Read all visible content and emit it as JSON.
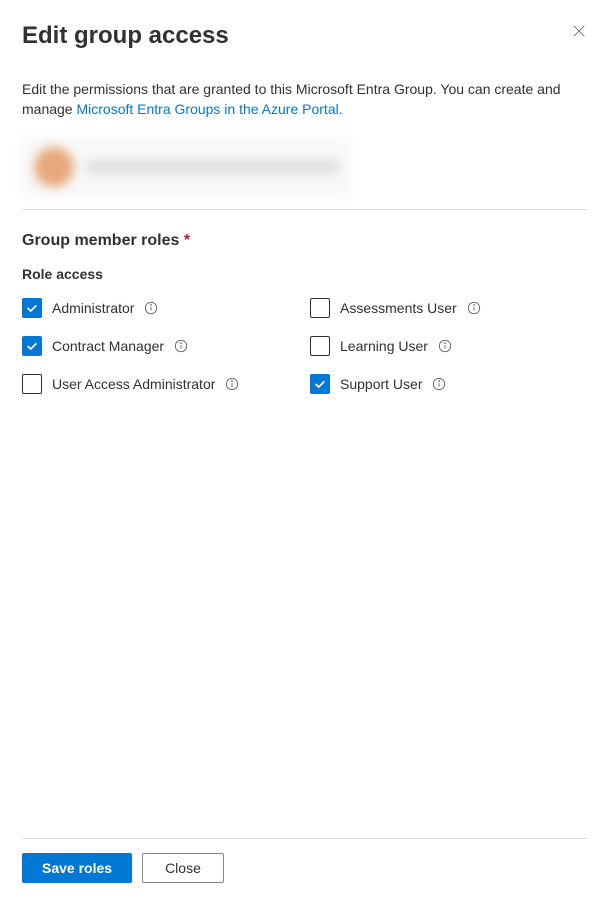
{
  "header": {
    "title": "Edit group access"
  },
  "description": {
    "text_before_link": "Edit the permissions that are granted to this Microsoft Entra Group. You can create and manage ",
    "link_text": "Microsoft Entra Groups in the Azure Portal."
  },
  "section": {
    "title": "Group member roles",
    "required_marker": "*",
    "subtitle": "Role access"
  },
  "roles": [
    {
      "label": "Administrator",
      "checked": true
    },
    {
      "label": "Assessments User",
      "checked": false
    },
    {
      "label": "Contract Manager",
      "checked": true
    },
    {
      "label": "Learning User",
      "checked": false
    },
    {
      "label": "User Access Administrator",
      "checked": false
    },
    {
      "label": "Support User",
      "checked": true
    }
  ],
  "footer": {
    "save_label": "Save roles",
    "close_label": "Close"
  }
}
